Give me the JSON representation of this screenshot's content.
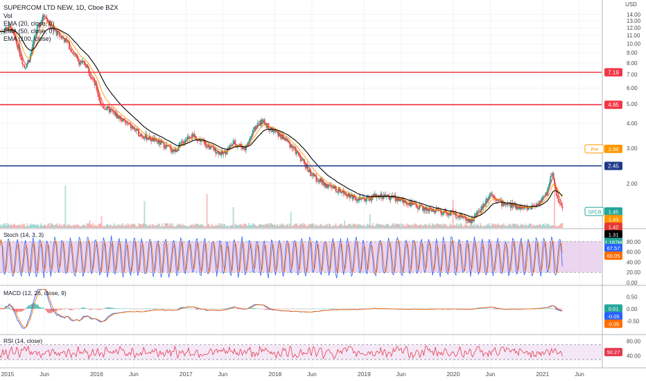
{
  "header": {
    "symbol_title": "SUPERCOM LTD NEW, 1D, Cboe BZX",
    "indicators": [
      "Vol",
      "EMA (20, close, 0)",
      "EMA (50, close, 0)",
      "EMA (100, close)"
    ],
    "currency": "USD"
  },
  "colors": {
    "candle_up": "#26a69a",
    "candle_down": "#ef5350",
    "ema20": "#e53935",
    "ema50": "#ff9800",
    "ema100": "#000000",
    "red_level": "#f23645",
    "blue_level": "#1e3a8a",
    "stoch_k": "#2962ff",
    "stoch_d": "#ff6d00",
    "stoch_band": "#e1bee7",
    "rsi_line": "#e53950",
    "rsi_band": "#f3e5f5",
    "axis_text": "#4a4a4a",
    "grid": "#f0f3fa"
  },
  "chart_data": [
    {
      "type": "candlestick",
      "title": "SUPERCOM LTD NEW, 1D, Cboe BZX",
      "y_scale": "log",
      "ylim": [
        1.2,
        16
      ],
      "x_range": [
        "2014-12-01",
        "2021-08-31"
      ],
      "x_tick_labels": [
        {
          "date": "2015-01-01",
          "label": "2015"
        },
        {
          "date": "2015-06-01",
          "label": "Jun"
        },
        {
          "date": "2016-01-01",
          "label": "2016"
        },
        {
          "date": "2016-06-01",
          "label": "Jun"
        },
        {
          "date": "2017-01-01",
          "label": "2017"
        },
        {
          "date": "2017-06-01",
          "label": "Jun"
        },
        {
          "date": "2018-01-01",
          "label": "2018"
        },
        {
          "date": "2018-06-01",
          "label": "Jun"
        },
        {
          "date": "2019-01-01",
          "label": "2019"
        },
        {
          "date": "2019-06-01",
          "label": "Jun"
        },
        {
          "date": "2020-01-01",
          "label": "2020"
        },
        {
          "date": "2020-06-01",
          "label": "Jun"
        },
        {
          "date": "2021-01-01",
          "label": "2021"
        },
        {
          "date": "2021-06-01",
          "label": "Jun"
        }
      ],
      "y_ticks": [
        2.0,
        3.0,
        4.0,
        5.0,
        6.0,
        7.0,
        8.0,
        9.0,
        10.0,
        11.0,
        12.0,
        13.0,
        14.0
      ],
      "price_path": [
        {
          "date": "2014-12-01",
          "value": 11.5
        },
        {
          "date": "2015-01-10",
          "value": 12.2
        },
        {
          "date": "2015-02-15",
          "value": 9.5
        },
        {
          "date": "2015-03-10",
          "value": 7.6
        },
        {
          "date": "2015-04-01",
          "value": 8.4
        },
        {
          "date": "2015-04-25",
          "value": 11.2
        },
        {
          "date": "2015-05-15",
          "value": 12.8
        },
        {
          "date": "2015-06-05",
          "value": 14.2
        },
        {
          "date": "2015-06-20",
          "value": 12.5
        },
        {
          "date": "2015-07-15",
          "value": 11.5
        },
        {
          "date": "2015-09-01",
          "value": 10.2
        },
        {
          "date": "2015-10-15",
          "value": 8.2
        },
        {
          "date": "2015-11-20",
          "value": 7.8
        },
        {
          "date": "2015-12-31",
          "value": 6.0
        },
        {
          "date": "2016-01-20",
          "value": 4.9
        },
        {
          "date": "2016-03-01",
          "value": 4.6
        },
        {
          "date": "2016-05-01",
          "value": 4.0
        },
        {
          "date": "2016-07-01",
          "value": 3.5
        },
        {
          "date": "2016-09-15",
          "value": 3.2
        },
        {
          "date": "2016-11-15",
          "value": 2.9
        },
        {
          "date": "2017-01-15",
          "value": 3.5
        },
        {
          "date": "2017-03-01",
          "value": 3.3
        },
        {
          "date": "2017-04-15",
          "value": 3.0
        },
        {
          "date": "2017-06-01",
          "value": 2.8
        },
        {
          "date": "2017-07-15",
          "value": 3.2
        },
        {
          "date": "2017-09-01",
          "value": 3.0
        },
        {
          "date": "2017-10-15",
          "value": 3.9
        },
        {
          "date": "2017-11-10",
          "value": 4.1
        },
        {
          "date": "2017-12-20",
          "value": 3.7
        },
        {
          "date": "2018-02-15",
          "value": 3.3
        },
        {
          "date": "2018-04-15",
          "value": 2.7
        },
        {
          "date": "2018-06-01",
          "value": 2.2
        },
        {
          "date": "2018-08-01",
          "value": 1.95
        },
        {
          "date": "2018-10-15",
          "value": 1.8
        },
        {
          "date": "2018-12-20",
          "value": 1.65
        },
        {
          "date": "2019-03-01",
          "value": 1.75
        },
        {
          "date": "2019-05-01",
          "value": 1.7
        },
        {
          "date": "2019-07-01",
          "value": 1.6
        },
        {
          "date": "2019-09-01",
          "value": 1.5
        },
        {
          "date": "2019-11-01",
          "value": 1.45
        },
        {
          "date": "2020-01-15",
          "value": 1.4
        },
        {
          "date": "2020-03-15",
          "value": 1.3
        },
        {
          "date": "2020-05-01",
          "value": 1.55
        },
        {
          "date": "2020-06-01",
          "value": 1.8
        },
        {
          "date": "2020-07-15",
          "value": 1.6
        },
        {
          "date": "2020-09-01",
          "value": 1.55
        },
        {
          "date": "2020-11-01",
          "value": 1.5
        },
        {
          "date": "2020-12-15",
          "value": 1.6
        },
        {
          "date": "2021-01-15",
          "value": 1.75
        },
        {
          "date": "2021-02-10",
          "value": 2.3
        },
        {
          "date": "2021-03-01",
          "value": 1.7
        },
        {
          "date": "2021-03-25",
          "value": 1.45
        }
      ],
      "horizontal_levels": [
        {
          "value": 7.19,
          "color": "#f23645",
          "label": "7.19"
        },
        {
          "value": 4.95,
          "color": "#f23645",
          "label": "4.95"
        },
        {
          "value": 2.45,
          "color": "#1e3a8a",
          "label": "2.45"
        }
      ],
      "price_labels": [
        {
          "text": "2.98",
          "prefix": "Pre",
          "color": "#ff9800",
          "value": 2.98
        },
        {
          "text": "1.45",
          "prefix": "SPCB",
          "color": "#26a69a",
          "value": 1.45
        },
        {
          "text": "1.43",
          "prefix": "",
          "color": "#ff9800",
          "value": 1.43
        },
        {
          "text": "1.42",
          "prefix": "",
          "color": "#e53935",
          "value": 1.42
        },
        {
          "text": "1.31",
          "prefix": "",
          "color": "#000000",
          "value": 1.31
        },
        {
          "text": "1.187M",
          "prefix": "",
          "color": "#26a69a",
          "value": 1.24
        }
      ]
    },
    {
      "type": "line",
      "title": "Stoch (14, 3, 3)",
      "ylim": [
        0,
        100
      ],
      "y_ticks": [
        0,
        20,
        40,
        60,
        80
      ],
      "y_tick_labels": [
        "0.00",
        "20.00",
        "40.00",
        "60.00",
        "80.00"
      ],
      "band": [
        20,
        80
      ],
      "series": [
        {
          "name": "",
          "color": "#2962ff",
          "last_value": 67.57,
          "last_label": "67.57"
        },
        {
          "name": "",
          "color": "#ff6d00",
          "last_value": 60.05,
          "last_label": "60.05"
        }
      ]
    },
    {
      "type": "line",
      "title": "MACD (12, 26, close, 9)",
      "ylim": [
        -0.95,
        0.85
      ],
      "y_ticks": [
        0.5,
        0.0,
        -0.5
      ],
      "y_tick_labels": [
        "0.50",
        "0.00",
        "-0.50"
      ],
      "series": [
        {
          "name": "",
          "color": "#26a69a",
          "last_value": 0.01,
          "last_label": "0.01"
        },
        {
          "name": "",
          "color": "#2962ff",
          "last_value": -0.05,
          "last_label": "-0.05"
        },
        {
          "name": "",
          "color": "#ff6d00",
          "last_value": -0.05,
          "last_label": "-0.05"
        }
      ]
    },
    {
      "type": "line",
      "title": "RSI (14, close)",
      "ylim": [
        15,
        90
      ],
      "y_ticks": [
        80,
        40
      ],
      "y_tick_labels": [
        "80.00",
        "40.00"
      ],
      "band": [
        30,
        70
      ],
      "series": [
        {
          "name": "",
          "color": "#e53950",
          "last_value": 50.27,
          "last_label": "50.27"
        }
      ]
    }
  ]
}
